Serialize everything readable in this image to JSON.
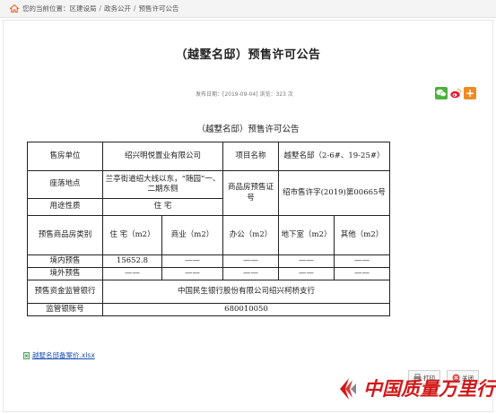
{
  "breadcrumb": {
    "prefix": "您的当前位置：",
    "items": [
      "区建设局",
      "政务公开",
      "预售许可公告"
    ],
    "separator": "/"
  },
  "article": {
    "title": "（越墅名邸）预售许可公告",
    "meta": "发布日期：[2019-09-04] 浏览：323 次",
    "doc_title": "（越墅名邸）预售许可公告"
  },
  "share": {
    "icons": [
      "wechat-icon",
      "weibo-icon",
      "more-share-icon"
    ],
    "plus_glyph": "+"
  },
  "permit_table": {
    "r1": {
      "seller_label": "售房单位",
      "seller_value": "绍兴明悦置业有限公司",
      "project_label": "项目名称",
      "project_value": "越墅名邸（2-6#、19-25#）"
    },
    "r2": {
      "location_label": "座落地点",
      "location_value": "兰亭街道绍大线以东，“随园”一、二期东侧",
      "cert_label": "商品房预售证号",
      "cert_value": "绍市售许字(2019)第00665号"
    },
    "r3": {
      "usage_label": "用途性质",
      "usage_value": "住 宅"
    },
    "r4": {
      "category_label": "预售商品房类别",
      "c1": "住 宅（m2）",
      "c2": "商业（m2）",
      "c3": "办公（m2）",
      "c4": "地下室（m2）",
      "c5": "其他（m2）"
    },
    "r5": {
      "label": "境内预售",
      "c1": "15652.8",
      "c2": "——",
      "c3": "——",
      "c4": "——",
      "c5": "——"
    },
    "r6": {
      "label": "境外预售",
      "c1": "——",
      "c2": "——",
      "c3": "——",
      "c4": "——",
      "c5": "——"
    },
    "r7": {
      "label": "预售资金监管银行",
      "value": "中国民生银行股份有限公司绍兴柯桥支行"
    },
    "r8": {
      "label": "监管银账号",
      "value": "680010050"
    }
  },
  "attachment": {
    "filename": "越墅名邸备案价.xlsx"
  },
  "buttons": {
    "print": "打印",
    "close": "关闭"
  },
  "watermark": {
    "text": "中国质量万里行"
  },
  "colors": {
    "link": "#1a4fb3",
    "watermark": "#d11a1a",
    "home_icon": "#e85c1f"
  }
}
